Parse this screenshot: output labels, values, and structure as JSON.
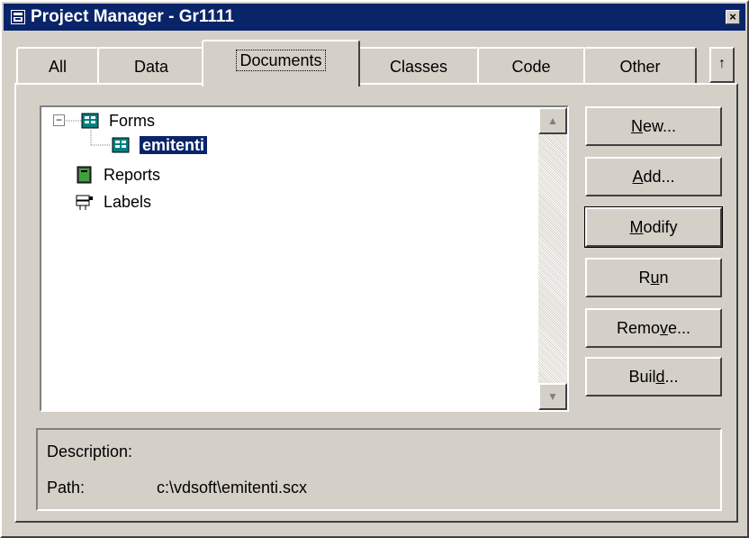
{
  "window": {
    "title": "Project Manager - Gr1111",
    "close_symbol": "×"
  },
  "tabs": [
    {
      "label": "All"
    },
    {
      "label": "Data"
    },
    {
      "label": "Documents",
      "active": true
    },
    {
      "label": "Classes"
    },
    {
      "label": "Code"
    },
    {
      "label": "Other"
    }
  ],
  "tab_scroll_symbol": "↑",
  "tree": {
    "items": [
      {
        "label": "Forms",
        "icon": "form-icon",
        "expanded": true,
        "expander_symbol": "−"
      },
      {
        "label": "emitenti",
        "icon": "form-icon",
        "selected": true
      },
      {
        "label": "Reports",
        "icon": "report-icon"
      },
      {
        "label": "Labels",
        "icon": "label-icon"
      }
    ],
    "scroll_up_symbol": "▲",
    "scroll_down_symbol": "▼"
  },
  "buttons": {
    "new": {
      "pre": "",
      "key": "N",
      "post": "ew..."
    },
    "add": {
      "pre": "",
      "key": "A",
      "post": "dd..."
    },
    "modify": {
      "pre": "",
      "key": "M",
      "post": "odify"
    },
    "run": {
      "pre": "R",
      "key": "u",
      "post": "n"
    },
    "remove": {
      "pre": "Remo",
      "key": "v",
      "post": "e..."
    },
    "build": {
      "pre": "Buil",
      "key": "d",
      "post": "..."
    }
  },
  "details": {
    "description_label": "Description:",
    "path_label": "Path:",
    "path_value": "c:\\vdsoft\\emitenti.scx"
  },
  "colors": {
    "titlebar": "#0a246a",
    "face": "#d4d0c8",
    "selection": "#0a246a"
  }
}
